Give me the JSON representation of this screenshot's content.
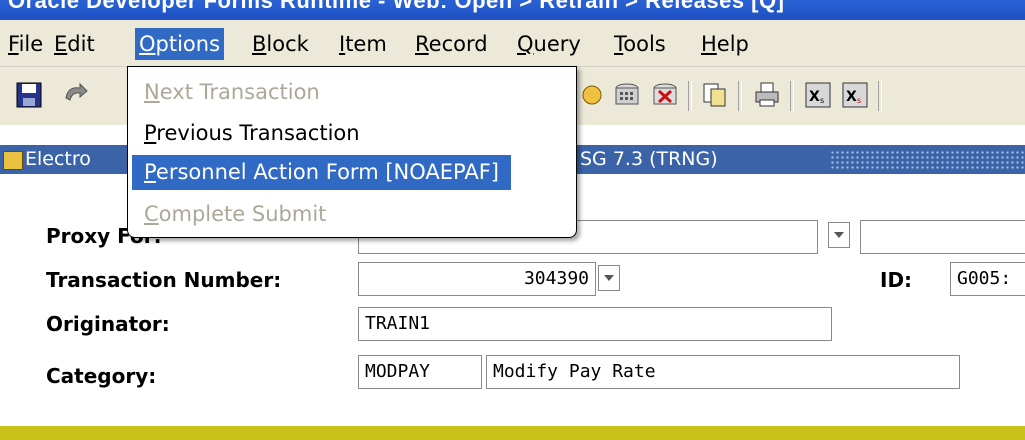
{
  "title_bar": {
    "text": "Oracle Developer Forms Runtime - Web: Open > Retrain > Releases [Q]"
  },
  "menu": {
    "items": [
      {
        "label": "File",
        "hotkey": "F",
        "rest": "ile"
      },
      {
        "label": "Edit",
        "hotkey": "E",
        "rest": "dit"
      },
      {
        "label": "Options",
        "hotkey": "O",
        "rest": "ptions"
      },
      {
        "label": "Block",
        "hotkey": "B",
        "rest": "lock"
      },
      {
        "label": "Item",
        "hotkey": "I",
        "rest": "tem"
      },
      {
        "label": "Record",
        "hotkey": "R",
        "rest": "ecord"
      },
      {
        "label": "Query",
        "hotkey": "Q",
        "rest": "uery"
      },
      {
        "label": "Tools",
        "hotkey": "T",
        "rest": "ools"
      },
      {
        "label": "Help",
        "hotkey": "H",
        "rest": "elp"
      }
    ],
    "active": "Options"
  },
  "options_menu": {
    "items": [
      {
        "hotkey": "N",
        "rest": "ext Transaction",
        "enabled": false,
        "selected": false
      },
      {
        "hotkey": "P",
        "rest": "revious Transaction",
        "enabled": true,
        "selected": false
      },
      {
        "hotkey": "P",
        "rest": "ersonnel Action Form [NOAEPAF]",
        "enabled": true,
        "selected": true
      },
      {
        "hotkey": "C",
        "rest": "omplete Submit",
        "enabled": false,
        "selected": false
      }
    ]
  },
  "window": {
    "title": "Electro",
    "version": "SG 7.3 (TRNG)"
  },
  "form": {
    "proxy_for_label": "Proxy For:",
    "transaction_number_label": "Transaction Number:",
    "transaction_number_value": "304390",
    "id_label": "ID:",
    "id_value": "G005:",
    "originator_label": "Originator:",
    "originator_value": "TRAIN1",
    "category_label": "Category:",
    "category_code": "MODPAY",
    "category_desc": "Modify Pay Rate"
  },
  "colors": {
    "menu_highlight": "#316ac5",
    "window_caption": "#3b64a8",
    "bottom_bar": "#c9c219"
  }
}
